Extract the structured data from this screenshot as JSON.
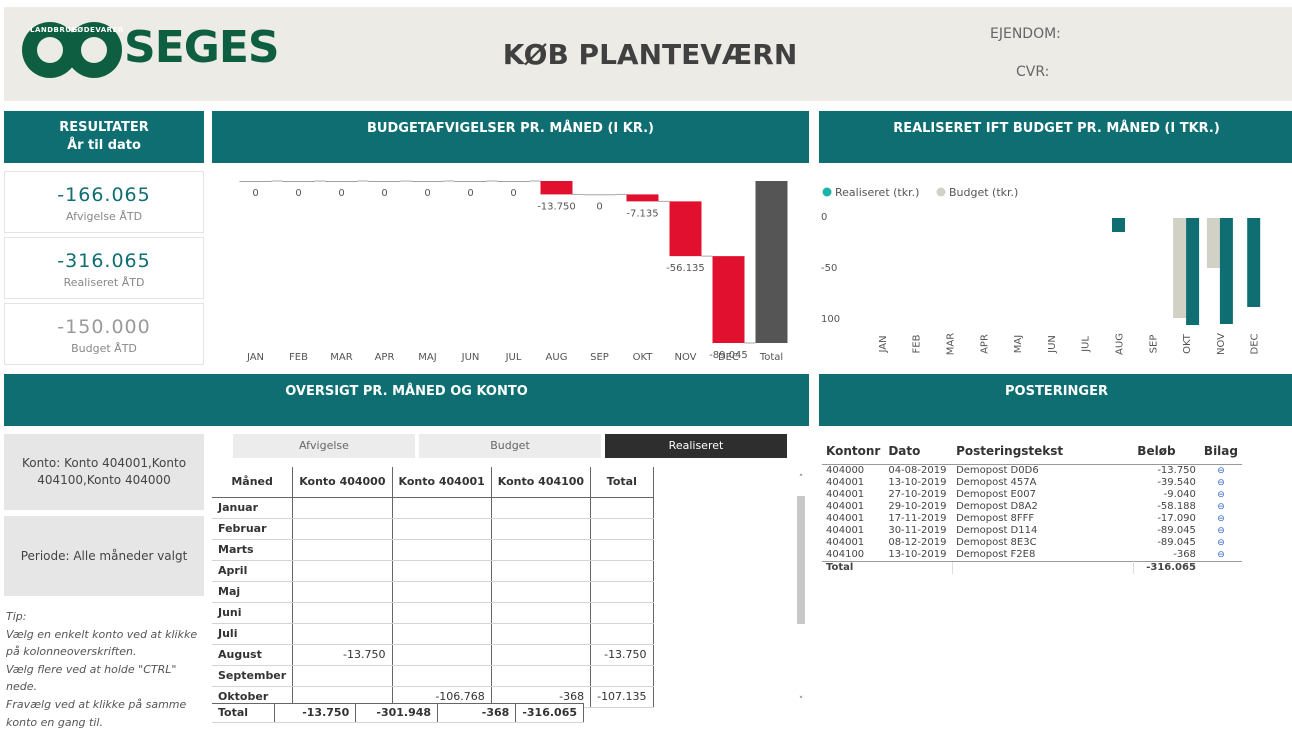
{
  "header": {
    "title": "KØB PLANTEVÆRN",
    "ejendom_label": "EJENDOM:",
    "cvr_label": "CVR:",
    "logo_word": "SEGES",
    "logo_ring_left": "LANDBRUG",
    "logo_ring_right": "FØDEVARER"
  },
  "panels": {
    "resultater_title": "RESULTATER",
    "resultater_sub": "År til dato",
    "budgetafv_title": "BUDGETAFVIGELSER PR. MÅNED (I KR.)",
    "realiseret_title": "REALISERET IFT BUDGET PR. MÅNED (I TKR.)",
    "oversigt_title": "OVERSIGT PR. MÅNED OG KONTO",
    "posteringer_title": "POSTERINGER"
  },
  "kpis": [
    {
      "value": "-166.065",
      "label": "Afvigelse ÅTD",
      "color": "#0e6e72"
    },
    {
      "value": "-316.065",
      "label": "Realiseret ÅTD",
      "color": "#0e6e72"
    },
    {
      "value": "-150.000",
      "label": "Budget ÅTD",
      "color": "#9a9a9a"
    }
  ],
  "filters": {
    "konto": "Konto: Konto 404001,Konto 404100,Konto 404000",
    "periode": "Periode: Alle måneder valgt"
  },
  "tip": {
    "title": "Tip:",
    "lines": [
      "Vælg en enkelt konto ved at klikke på kolonneoverskriften.",
      "Vælg flere ved at holde \"CTRL\" nede.",
      "Fravælg ved at klikke på samme konto en gang til."
    ]
  },
  "tabs": [
    "Afvigelse",
    "Budget",
    "Realiseret"
  ],
  "active_tab": "Realiseret",
  "matrix": {
    "headers": [
      "Måned",
      "Konto 404000",
      "Konto 404001",
      "Konto 404100",
      "Total"
    ],
    "rows": [
      [
        "Januar",
        "",
        "",
        "",
        ""
      ],
      [
        "Februar",
        "",
        "",
        "",
        ""
      ],
      [
        "Marts",
        "",
        "",
        "",
        ""
      ],
      [
        "April",
        "",
        "",
        "",
        ""
      ],
      [
        "Maj",
        "",
        "",
        "",
        ""
      ],
      [
        "Juni",
        "",
        "",
        "",
        ""
      ],
      [
        "Juli",
        "",
        "",
        "",
        ""
      ],
      [
        "August",
        "-13.750",
        "",
        "",
        "-13.750"
      ],
      [
        "September",
        "",
        "",
        "",
        ""
      ],
      [
        "Oktober",
        "",
        "-106.768",
        "-368",
        "-107.135"
      ]
    ],
    "total": [
      "Total",
      "-13.750",
      "-301.948",
      "-368",
      "-316.065"
    ]
  },
  "posteringer": {
    "headers": [
      "Kontonr",
      "Dato",
      "Posteringstekst",
      "Beløb",
      "Bilag"
    ],
    "rows": [
      [
        "404000",
        "04-08-2019",
        "Demopost D0D6",
        "-13.750"
      ],
      [
        "404001",
        "13-10-2019",
        "Demopost 457A",
        "-39.540"
      ],
      [
        "404001",
        "27-10-2019",
        "Demopost E007",
        "-9.040"
      ],
      [
        "404001",
        "29-10-2019",
        "Demopost D8A2",
        "-58.188"
      ],
      [
        "404001",
        "17-11-2019",
        "Demopost 8FFF",
        "-17.090"
      ],
      [
        "404001",
        "30-11-2019",
        "Demopost D114",
        "-89.045"
      ],
      [
        "404001",
        "08-12-2019",
        "Demopost 8E3C",
        "-89.045"
      ],
      [
        "404100",
        "13-10-2019",
        "Demopost F2E8",
        "-368"
      ]
    ],
    "total_label": "Total",
    "total_value": "-316.065",
    "link_icon": "link-icon"
  },
  "chart_data": [
    {
      "type": "bar",
      "subtype": "waterfall",
      "title": "BUDGETAFVIGELSER PR. MÅNED (I KR.)",
      "categories": [
        "JAN",
        "FEB",
        "MAR",
        "APR",
        "MAJ",
        "JUN",
        "JUL",
        "AUG",
        "SEP",
        "OKT",
        "NOV",
        "DEC",
        "Total"
      ],
      "values": [
        0,
        0,
        0,
        0,
        0,
        0,
        0,
        -13750,
        0,
        -7135,
        -56135,
        -89045,
        -166065
      ],
      "data_labels": [
        "0",
        "0",
        "0",
        "0",
        "0",
        "0",
        "0",
        "-13.750",
        "0",
        "-7.135",
        "-56.135",
        "-89.045",
        ""
      ],
      "colors": {
        "decrease": "#e0102e",
        "total": "#555555"
      }
    },
    {
      "type": "bar",
      "title": "REALISERET IFT BUDGET PR. MÅNED (I TKR.)",
      "categories": [
        "JAN",
        "FEB",
        "MAR",
        "APR",
        "MAJ",
        "JUN",
        "JUL",
        "AUG",
        "SEP",
        "OKT",
        "NOV",
        "DEC"
      ],
      "series": [
        {
          "name": "Realiseret (tkr.)",
          "color": "#0e6e72",
          "values": [
            0,
            0,
            0,
            0,
            0,
            0,
            0,
            -14,
            0,
            -107,
            -106,
            -89
          ]
        },
        {
          "name": "Budget (tkr.)",
          "color": "#d2d1c5",
          "values": [
            0,
            0,
            0,
            0,
            0,
            0,
            0,
            0,
            0,
            -100,
            -50,
            0
          ]
        }
      ],
      "y_ticks": [
        "0",
        "-50",
        "100"
      ],
      "ylim": [
        -100,
        0
      ],
      "legend": "top-left"
    }
  ]
}
